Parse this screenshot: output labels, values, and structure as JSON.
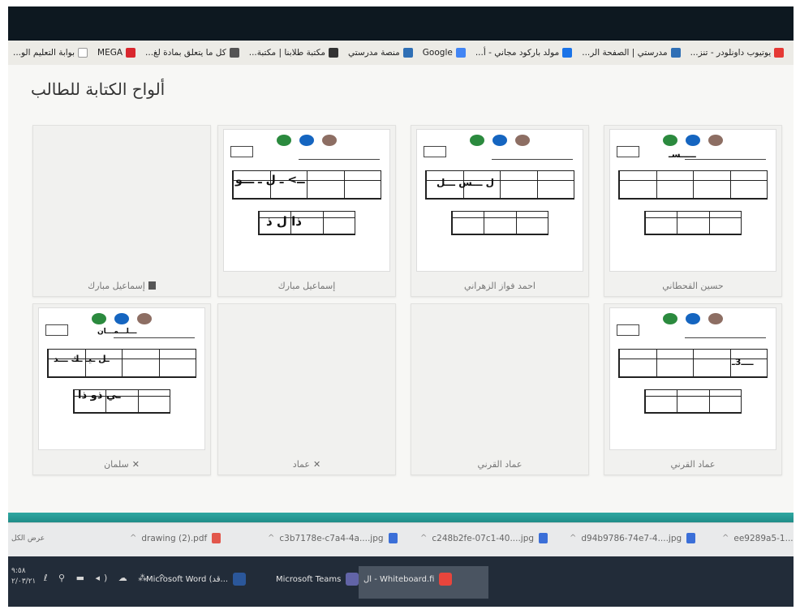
{
  "bookmarks": [
    {
      "label": "بوابة التعليم الو...",
      "icon": "globe-icon",
      "color": "#ffffff"
    },
    {
      "label": "MEGA",
      "icon": "mega-icon",
      "color": "#d9272e"
    },
    {
      "label": "كل ما يتعلق بمادة لغ...",
      "icon": "book-icon",
      "color": "#555555"
    },
    {
      "label": "مكتبة طلابنا | مكتبة...",
      "icon": "circle-icon",
      "color": "#333333"
    },
    {
      "label": "منصة مدرستي",
      "icon": "page-icon",
      "color": "#2f6fb5"
    },
    {
      "label": "Google",
      "icon": "google-icon",
      "color": "#4285f4"
    },
    {
      "label": "مولد باركود مجاني - أ...",
      "icon": "barcode-icon",
      "color": "#1a73e8"
    },
    {
      "label": "مدرستي | الصفحة الر...",
      "icon": "page-icon",
      "color": "#2f6fb5"
    },
    {
      "label": "يوتيوب داونلودر - تنز...",
      "icon": "youtube-icon",
      "color": "#e53935"
    }
  ],
  "page": {
    "title": "ألواح الكتابة للطالب"
  },
  "cards": [
    {
      "name": "إسماعيل مبارك",
      "has_sheet": false,
      "label_icon": "user-icon"
    },
    {
      "name": "إسماعيل مبارك",
      "has_sheet": true,
      "label_icon": ""
    },
    {
      "name": "احمد فواز الزهراني",
      "has_sheet": true,
      "label_icon": ""
    },
    {
      "name": "حسين القحطاني",
      "has_sheet": true,
      "label_icon": ""
    },
    {
      "name": "سلمان",
      "has_sheet": true,
      "label_icon": "mic-off-icon"
    },
    {
      "name": "عماد",
      "has_sheet": false,
      "label_icon": "mic-off-icon"
    },
    {
      "name": "عماد القرني",
      "has_sheet": false,
      "label_icon": ""
    },
    {
      "name": "عماد القرني",
      "has_sheet": true,
      "label_icon": ""
    }
  ],
  "downloads": {
    "left_label": "عرض الكل",
    "items": [
      {
        "label": "drawing (2).pdf",
        "type": "pdf",
        "color": "#e2574c"
      },
      {
        "label": "c3b7178e-c7a4-4a....jpg",
        "type": "jpg",
        "color": "#3b6fd8"
      },
      {
        "label": "c248b2fe-07c1-40....jpg",
        "type": "jpg",
        "color": "#3b6fd8"
      },
      {
        "label": "d94b9786-74e7-4....jpg",
        "type": "jpg",
        "color": "#3b6fd8"
      },
      {
        "label": "ee9289a5-1...",
        "type": "jpg",
        "color": "#3b6fd8"
      }
    ]
  },
  "taskbar": {
    "time": "٩:٥٨",
    "date": "٢/٠٣/٢١",
    "apps": [
      {
        "label": "Microsoft Word (قد...",
        "icon": "word-icon",
        "color": "#2b579a"
      },
      {
        "label": "Microsoft Teams",
        "icon": "teams-icon",
        "color": "#6264a7"
      },
      {
        "label": "ال - Whiteboard.fi",
        "icon": "chrome-icon",
        "color": "#e8453c",
        "active": true
      }
    ]
  }
}
